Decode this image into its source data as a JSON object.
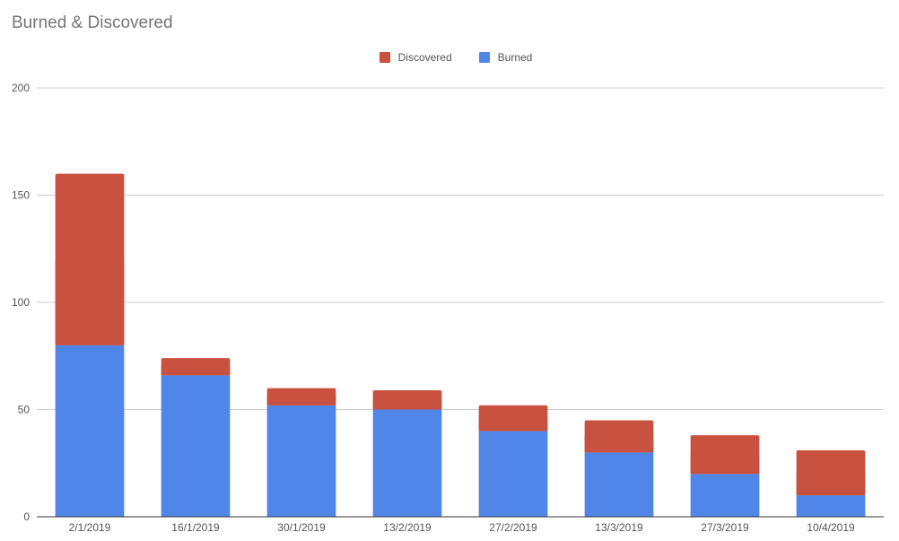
{
  "chart_data": {
    "type": "bar",
    "stacked": true,
    "title": "Burned & Discovered",
    "xlabel": "",
    "ylabel": "",
    "categories": [
      "2/1/2019",
      "16/1/2019",
      "30/1/2019",
      "13/2/2019",
      "27/2/2019",
      "13/3/2019",
      "27/3/2019",
      "10/4/2019"
    ],
    "series": [
      {
        "name": "Burned",
        "color": "#4f86e8",
        "values": [
          80,
          66,
          52,
          50,
          40,
          30,
          20,
          10
        ]
      },
      {
        "name": "Discovered",
        "color": "#c95140",
        "values": [
          80,
          8,
          8,
          9,
          12,
          15,
          18,
          21
        ]
      }
    ],
    "legend": {
      "position": "top",
      "order": [
        "Discovered",
        "Burned"
      ]
    },
    "ylim": [
      0,
      200
    ],
    "yticks": [
      0,
      50,
      100,
      150,
      200
    ],
    "grid": true
  }
}
